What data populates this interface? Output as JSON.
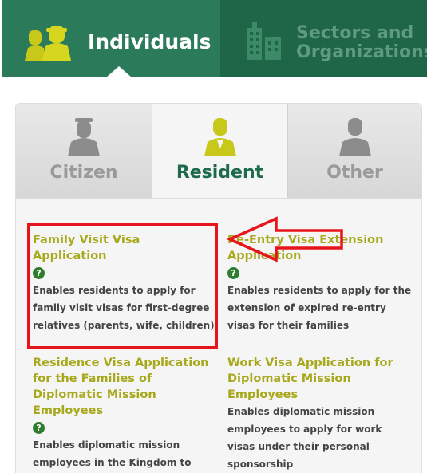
{
  "header": {
    "tabs": [
      {
        "label": "Individuals",
        "icon": "people-icon",
        "active": true
      },
      {
        "label": "Sectors and Organizations",
        "icon": "buildings-icon",
        "active": false
      }
    ]
  },
  "sub_tabs": [
    {
      "label": "Citizen",
      "icon": "citizen-person-icon",
      "active": false
    },
    {
      "label": "Resident",
      "icon": "resident-person-icon",
      "active": true
    },
    {
      "label": "Other",
      "icon": "other-person-icon",
      "active": false
    }
  ],
  "services": [
    {
      "title_lines": [
        "Family Visit Visa",
        "Application"
      ],
      "help": "?",
      "desc_lines": [
        "Enables residents to apply for",
        "family visit visas for first-degree",
        "relatives (parents, wife, children)"
      ]
    },
    {
      "title_lines": [
        "Re-Entry Visa Extension",
        "Application"
      ],
      "help": "?",
      "desc_lines": [
        "Enables residents to apply for the",
        "extension of expired re-entry",
        "visas for their families"
      ]
    },
    {
      "title_lines": [
        "Residence Visa Application",
        "for the Families of",
        "Diplomatic Mission",
        "Employees"
      ],
      "help": "?",
      "desc_lines": [
        "Enables diplomatic mission",
        "employees in the Kingdom to"
      ]
    },
    {
      "title_lines": [
        "Work Visa Application for",
        "Diplomatic Mission",
        "Employees"
      ],
      "desc_lines": [
        "Enables diplomatic mission",
        "employees to apply for work",
        "visas under their personal",
        "sponsorship"
      ]
    }
  ],
  "colors": {
    "header_active": "#2b7a5a",
    "header_inactive": "#1f6547",
    "icon_yellow": "#c8c81a",
    "service_title": "#a8a81c",
    "resident_label": "#1d6b4a",
    "annotation_red": "#e8141b"
  }
}
